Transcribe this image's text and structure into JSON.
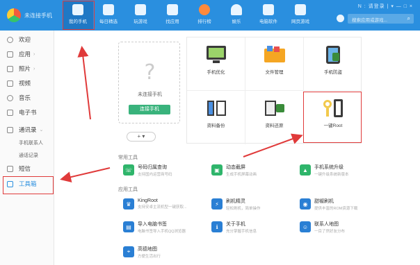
{
  "brand": {
    "name": "未连接手机"
  },
  "window": {
    "controls": "N : 请登录  | ▾ — □ ×"
  },
  "nav": [
    {
      "label": "我的手机",
      "icon": "phone-icon",
      "active": true
    },
    {
      "label": "每日精选",
      "icon": "calendar-icon"
    },
    {
      "label": "玩游戏",
      "icon": "game-icon"
    },
    {
      "label": "找应用",
      "icon": "lock-bag-icon"
    },
    {
      "label": "排行榜",
      "icon": "rank-icon"
    },
    {
      "label": "娱乐",
      "icon": "cloud-icon"
    },
    {
      "label": "电脑软件",
      "icon": "monitor-icon"
    },
    {
      "label": "网页游戏",
      "icon": "web-game-icon"
    }
  ],
  "search": {
    "placeholder": "搜索应用或游戏..."
  },
  "sidebar": {
    "items": [
      {
        "label": "欢迎",
        "icon": "welcome-icon"
      },
      {
        "label": "应用",
        "icon": "apps-icon",
        "chevron": "›"
      },
      {
        "label": "照片",
        "icon": "photo-icon",
        "chevron": "›"
      },
      {
        "label": "视频",
        "icon": "video-icon"
      },
      {
        "label": "音乐",
        "icon": "music-icon"
      },
      {
        "label": "电子书",
        "icon": "ebook-icon"
      },
      {
        "label": "通讯录",
        "icon": "contacts-icon",
        "chevron": "⌄"
      },
      {
        "label": "短信",
        "icon": "sms-icon"
      },
      {
        "label": "工具箱",
        "icon": "toolbox-icon",
        "active": true
      }
    ],
    "subitems": [
      "手机联系人",
      "通话记录"
    ]
  },
  "phone_card": {
    "question": "?",
    "label": "未连接手机",
    "connect_button": "连接手机",
    "dropdown": "+ ▾"
  },
  "tiles": [
    {
      "label": "手机优化",
      "icon": "optimize-icon"
    },
    {
      "label": "文件管理",
      "icon": "file-manager-icon"
    },
    {
      "label": "手机防盗",
      "icon": "anti-theft-icon"
    },
    {
      "label": "资料备份",
      "icon": "backup-icon"
    },
    {
      "label": "资料还原",
      "icon": "restore-icon"
    },
    {
      "label": "一键Root",
      "icon": "key-root-icon"
    }
  ],
  "sections": {
    "common": "常用工具",
    "apps": "应用工具"
  },
  "common_tools": [
    {
      "name": "号码归属查询",
      "desc": "支持国内运营商号码",
      "color": "#2fb56b"
    },
    {
      "name": "动态截屏",
      "desc": "生成手机屏幕动画",
      "color": "#2fb56b"
    },
    {
      "name": "手机系统升级",
      "desc": "一键升级系统新版本",
      "color": "#2fb56b"
    }
  ],
  "app_tools": [
    {
      "name": "KingRoot",
      "desc": "支持安卓主流机型一键获取...",
      "color": "#2a7fd4"
    },
    {
      "name": "刷机精灵",
      "desc": "轻松刷机，简单操作",
      "color": "#2a7fd4"
    },
    {
      "name": "甜椒刷机",
      "desc": "提供丰富的ROM资源下载",
      "color": "#2a7fd4"
    },
    {
      "name": "导入电脑书签",
      "desc": "电脑书签导入手机QQ浏览器",
      "color": "#2a7fd4"
    },
    {
      "name": "关于手机",
      "desc": "充分掌握手机信息",
      "color": "#2a7fd4"
    },
    {
      "name": "联系人地图",
      "desc": "一目了然好友分布",
      "color": "#2a7fd4"
    },
    {
      "name": "高德地图",
      "desc": "方便生活出行",
      "color": "#2a7fd4"
    }
  ]
}
